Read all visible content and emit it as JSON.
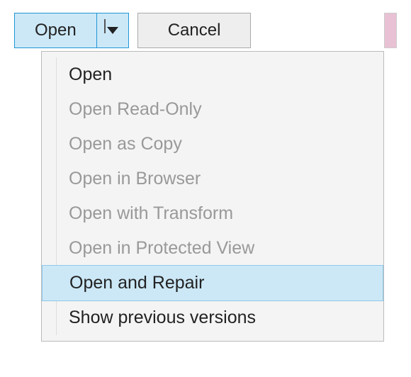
{
  "buttons": {
    "open": "Open",
    "cancel": "Cancel"
  },
  "menu": {
    "items": [
      {
        "label": "Open",
        "enabled": true,
        "highlighted": false
      },
      {
        "label": "Open Read-Only",
        "enabled": false,
        "highlighted": false
      },
      {
        "label": "Open as Copy",
        "enabled": false,
        "highlighted": false
      },
      {
        "label": "Open in Browser",
        "enabled": false,
        "highlighted": false
      },
      {
        "label": "Open with Transform",
        "enabled": false,
        "highlighted": false
      },
      {
        "label": "Open in Protected View",
        "enabled": false,
        "highlighted": false
      },
      {
        "label": "Open and Repair",
        "enabled": true,
        "highlighted": true
      },
      {
        "label": "Show previous versions",
        "enabled": true,
        "highlighted": false
      }
    ]
  }
}
